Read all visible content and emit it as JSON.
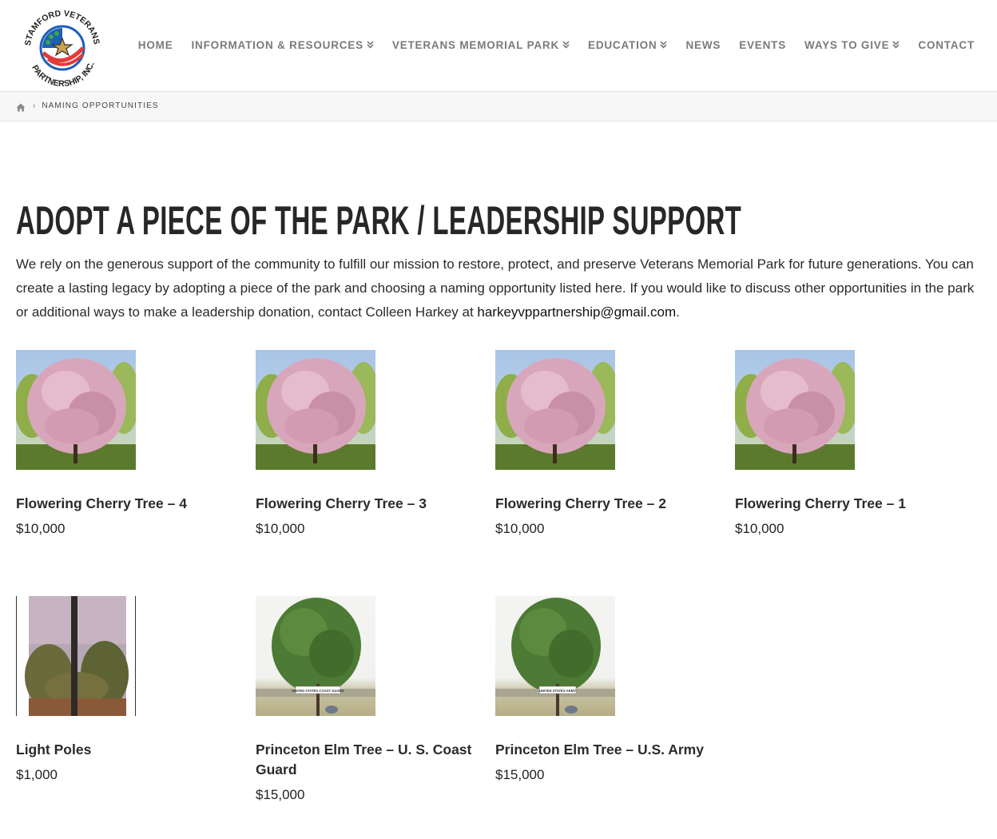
{
  "colors": {
    "nav_text": "#7a7a7a",
    "title_text": "#272727",
    "breadcrumb_bg": "#f7f7f7",
    "logo_red": "#e23b3b",
    "logo_blue": "#1c5fb8",
    "logo_green": "#3aa84a"
  },
  "logo": {
    "text_top": "STAMFORD VETERANS PARK",
    "text_bottom": "PARTNERSHIP, INC."
  },
  "nav": {
    "items": [
      {
        "label": "HOME",
        "dropdown": false
      },
      {
        "label": "INFORMATION & RESOURCES",
        "dropdown": true
      },
      {
        "label": "VETERANS MEMORIAL PARK",
        "dropdown": true
      },
      {
        "label": "EDUCATION",
        "dropdown": true
      },
      {
        "label": "NEWS",
        "dropdown": false
      },
      {
        "label": "EVENTS",
        "dropdown": false
      },
      {
        "label": "WAYS TO GIVE",
        "dropdown": true
      },
      {
        "label": "CONTACT",
        "dropdown": false
      }
    ]
  },
  "breadcrumb": {
    "home_icon": "home-icon",
    "current": "NAMING OPPORTUNITIES"
  },
  "page": {
    "title": "ADOPT A PIECE OF THE PARK / LEADERSHIP SUPPORT",
    "intro_text": "We rely on the generous support of the community to fulfill our mission to restore, protect, and preserve Veterans Memorial Park for future generations. You can create a lasting legacy by adopting a piece of the park and choosing a naming opportunity listed here. If you would like to discuss other opportunities in the park or additional ways to make a leadership donation, contact Colleen Harkey at ",
    "email": "harkeyvppartnership@gmail.com",
    "intro_end": "."
  },
  "products": [
    {
      "title": "Flowering Cherry Tree – 4",
      "price": "$10,000",
      "image": "cherry-tree"
    },
    {
      "title": "Flowering Cherry Tree – 3",
      "price": "$10,000",
      "image": "cherry-tree"
    },
    {
      "title": "Flowering Cherry Tree – 2",
      "price": "$10,000",
      "image": "cherry-tree"
    },
    {
      "title": "Flowering Cherry Tree – 1",
      "price": "$10,000",
      "image": "cherry-tree"
    },
    {
      "title": "Light Poles",
      "price": "$1,000",
      "image": "light-pole"
    },
    {
      "title": "Princeton Elm Tree – U. S. Coast Guard",
      "price": "$15,000",
      "image": "elm-tree",
      "sign": "UNITED STATES COAST GUARD"
    },
    {
      "title": "Princeton Elm Tree – U.S. Army",
      "price": "$15,000",
      "image": "elm-tree",
      "sign": "UNITED STATES ARMY"
    }
  ]
}
